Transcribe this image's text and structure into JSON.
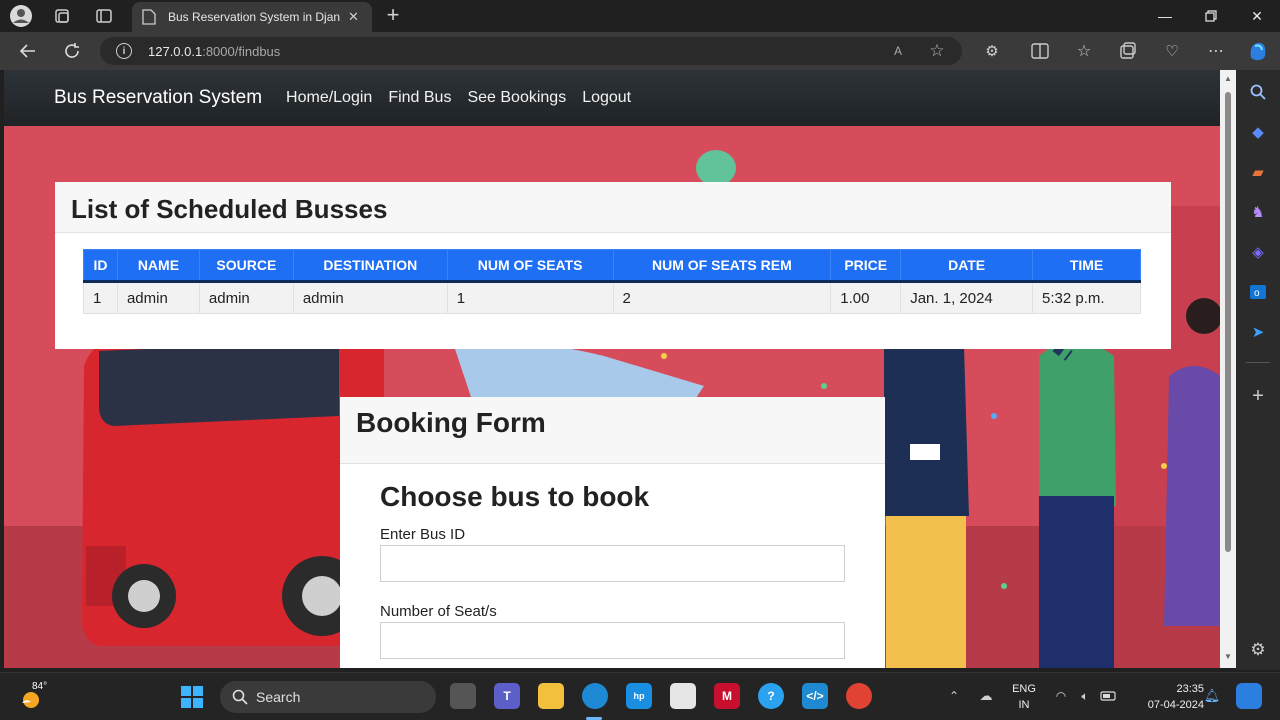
{
  "browser": {
    "tab_title": "Bus Reservation System in Djang",
    "url_host": "127.0.0.1",
    "url_rest": ":8000/findbus"
  },
  "navbar": {
    "brand": "Bus Reservation System",
    "links": [
      "Home/Login",
      "Find Bus",
      "See Bookings",
      "Logout"
    ]
  },
  "bus_list": {
    "title": "List of Scheduled Busses",
    "columns": [
      "ID",
      "NAME",
      "SOURCE",
      "DESTINATION",
      "NUM OF SEATS",
      "NUM OF SEATS REM",
      "PRICE",
      "DATE",
      "TIME"
    ],
    "rows": [
      [
        "1",
        "admin",
        "admin",
        "admin",
        "1",
        "2",
        "1.00",
        "Jan. 1, 2024",
        "5:32 p.m."
      ]
    ]
  },
  "booking_form": {
    "title": "Booking Form",
    "subtitle": "Choose bus to book",
    "bus_id_label": "Enter Bus ID",
    "bus_id_value": "",
    "seats_label": "Number of Seat/s",
    "seats_value": ""
  },
  "taskbar": {
    "weather_temp": "84°",
    "search_label": "Search",
    "lang_top": "ENG",
    "lang_bottom": "IN",
    "time": "23:35",
    "date": "07-04-2024"
  },
  "colors": {
    "accent_table": "#1f6ff5",
    "page_bg": "#d74c5b",
    "navbar": "#2a2e33"
  }
}
